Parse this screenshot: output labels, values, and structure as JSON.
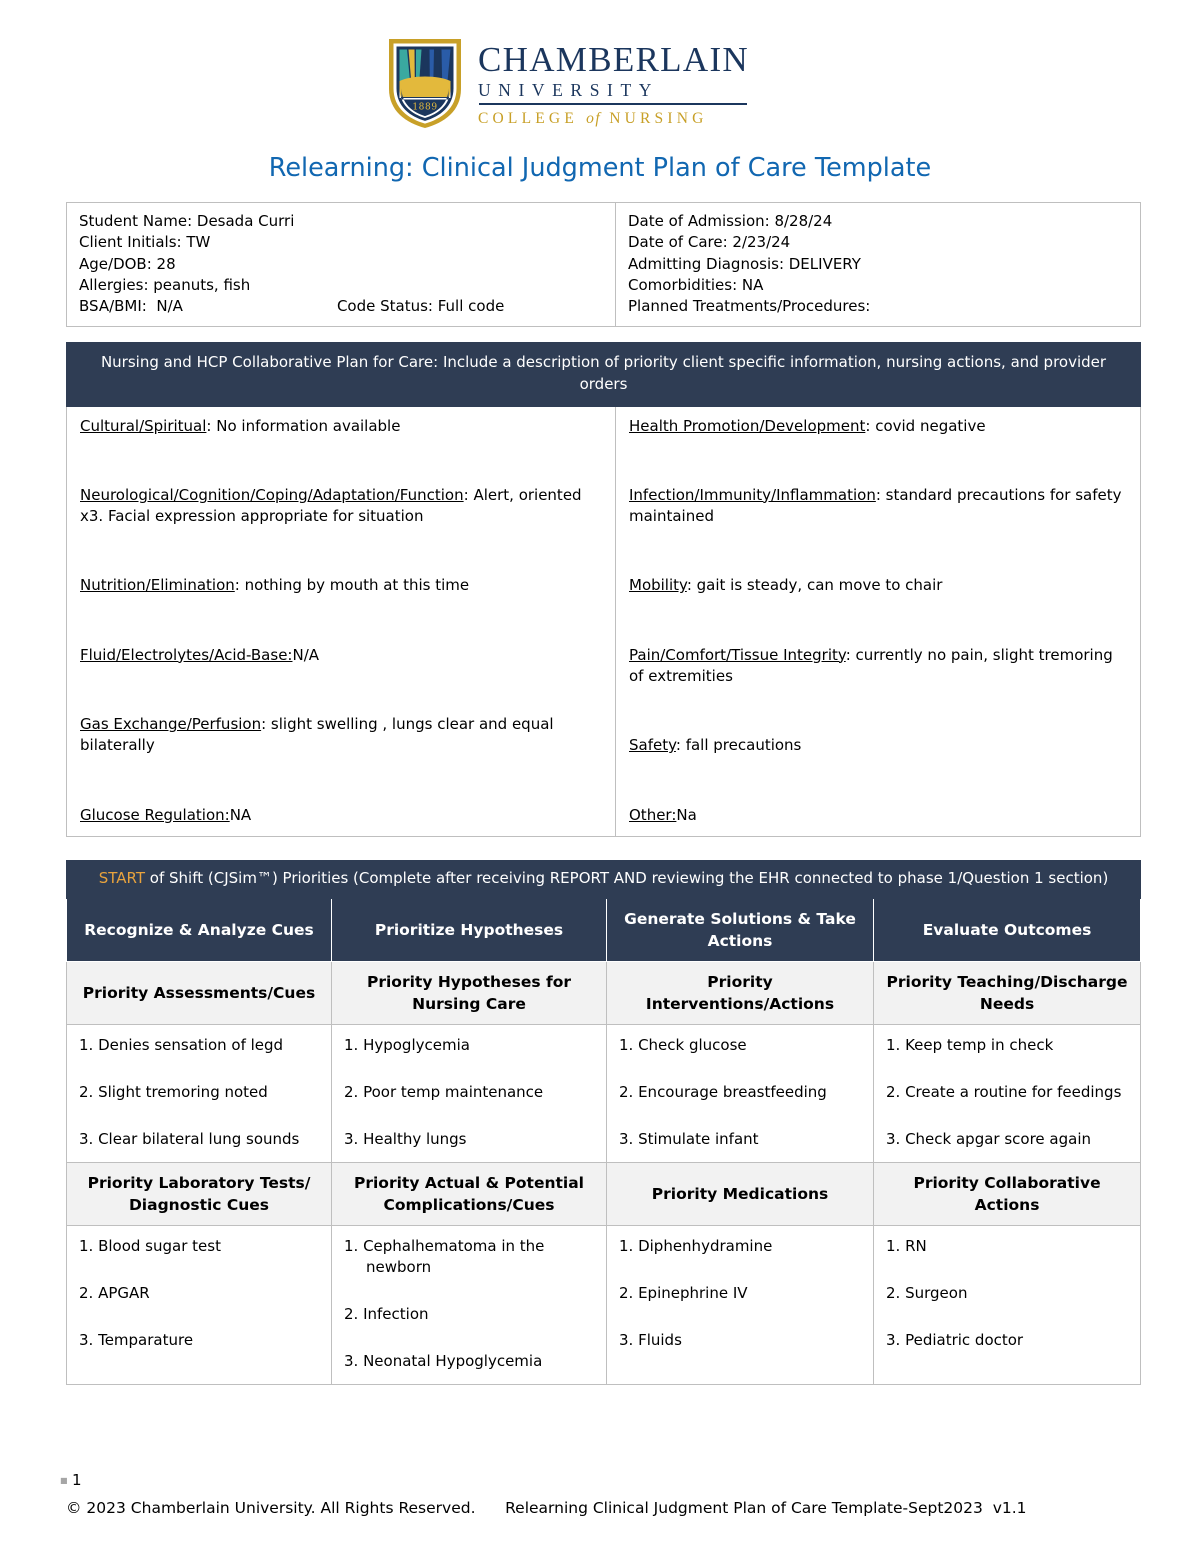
{
  "logo": {
    "name": "CHAMBERLAIN",
    "university": "UNIVERSITY",
    "college_pre": "COLLEGE ",
    "college_of": "of",
    "college_post": " NURSING",
    "founded_year": "1889",
    "colors": {
      "navy": "#1b365d",
      "gold": "#c8a028",
      "teal": "#3aa9a0"
    }
  },
  "title": "Relearning: Clinical Judgment Plan of Care Template",
  "title_color": "#1167b1",
  "demographics": {
    "left": [
      "Student Name: Desada Curri",
      "Client Initials: TW",
      "Age/DOB: 28",
      "Allergies: peanuts, fish"
    ],
    "bsa_bmi": "BSA/BMI:  N/A",
    "code_status": "Code Status: Full code",
    "right": [
      "Date of Admission: 8/28/24",
      "Date of Care: 2/23/24",
      "Admitting Diagnosis: DELIVERY",
      "Comorbidities: NA",
      "Planned Treatments/Procedures:"
    ]
  },
  "collaborative": {
    "band": "Nursing and HCP Collaborative Plan for Care: Include a description of priority client specific information, nursing actions, and provider orders",
    "left_items": [
      {
        "label": "Cultural/Spiritual",
        "value": ": No information available"
      },
      {
        "label": "Neurological/Cognition/Coping/Adaptation/Function",
        "value": ": Alert, oriented x3. Facial expression appropriate for situation"
      },
      {
        "label": "Nutrition/Elimination",
        "value": ": nothing by mouth at this time"
      },
      {
        "label": "Fluid/Electrolytes/Acid-Base:",
        "value": "N/A"
      },
      {
        "label": "Gas Exchange/Perfusion",
        "value": ": slight swelling , lungs clear and equal bilaterally"
      },
      {
        "label": "Glucose Regulation:",
        "value": "NA"
      }
    ],
    "right_items": [
      {
        "label": " Health Promotion/Development",
        "value": ": covid negative"
      },
      {
        "label": "Infection/Immunity/Inflammation",
        "value": ": standard precautions for safety maintained"
      },
      {
        "label": "Mobility",
        "value": ": gait is steady, can move to chair"
      },
      {
        "label": "Pain/Comfort/Tissue Integrity",
        "value": ": currently no pain, slight tremoring of extremities"
      },
      {
        "label": "Safety",
        "value": ": fall precautions"
      },
      {
        "label": "Other:",
        "value": "Na"
      }
    ]
  },
  "shift": {
    "band_start": "START",
    "band_rest": " of Shift (CJSim™) Priorities (Complete after receiving REPORT AND reviewing the EHR connected to phase 1/Question 1 section)",
    "col_headers": [
      "Recognize & Analyze Cues",
      "Prioritize Hypotheses",
      "Generate Solutions & Take Actions",
      "Evaluate Outcomes"
    ],
    "sub_headers_1": [
      "Priority Assessments/Cues",
      "Priority Hypotheses for Nursing Care",
      "Priority Interventions/Actions",
      "Priority Teaching/Discharge Needs"
    ],
    "row_1": [
      [
        "1. Denies sensation of legd",
        "2.  Slight tremoring noted",
        "3. Clear bilateral lung sounds"
      ],
      [
        "1.  Hypoglycemia",
        "2.  Poor temp maintenance",
        "3. Healthy lungs"
      ],
      [
        "1. Check glucose",
        "2.  Encourage breastfeeding",
        "3. Stimulate infant"
      ],
      [
        "1. Keep temp in check",
        "2.  Create a routine for feedings",
        "3. Check apgar score again"
      ]
    ],
    "sub_headers_2": [
      "Priority Laboratory Tests/ Diagnostic Cues",
      "Priority Actual & Potential Complications/Cues",
      "Priority Medications",
      "Priority Collaborative Actions"
    ],
    "row_2": [
      [
        "1. Blood sugar test",
        "2. APGAR",
        "3. Temparature"
      ],
      [
        "1. Cephalhematoma in the newborn",
        "2.  Infection",
        "3.  Neonatal Hypoglycemia"
      ],
      [
        "1. Diphenhydramine",
        "2.   Epinephrine IV",
        "3. Fluids"
      ],
      [
        "1. RN",
        "2.  Surgeon",
        "3. Pediatric doctor"
      ]
    ]
  },
  "footer": {
    "page_number": "1",
    "copyright": "© 2023 Chamberlain University. All Rights Reserved.",
    "template_id": "Relearning Clinical Judgment Plan of Care Template-Sept2023  v1.1"
  }
}
